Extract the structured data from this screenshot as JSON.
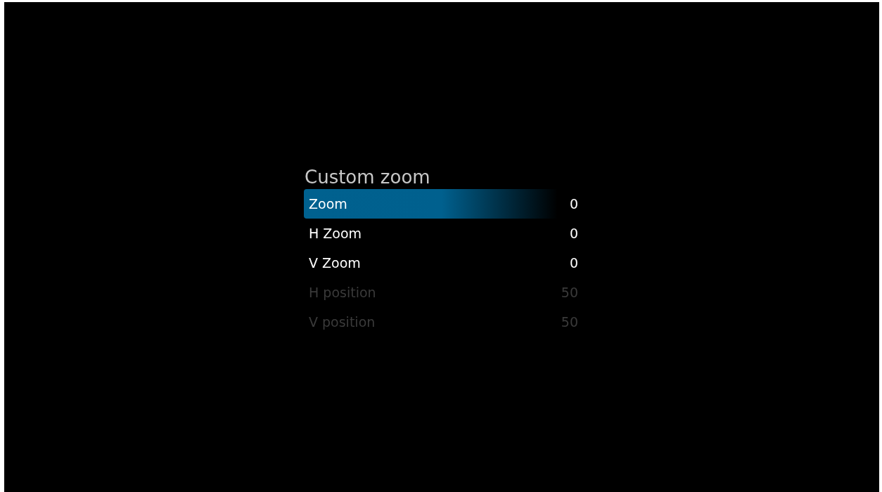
{
  "title": "Custom zoom",
  "items": [
    {
      "label": "Zoom",
      "value": "0",
      "selected": true,
      "disabled": false
    },
    {
      "label": "H Zoom",
      "value": "0",
      "selected": false,
      "disabled": false
    },
    {
      "label": "V Zoom",
      "value": "0",
      "selected": false,
      "disabled": false
    },
    {
      "label": "H position",
      "value": "50",
      "selected": false,
      "disabled": true
    },
    {
      "label": "V position",
      "value": "50",
      "selected": false,
      "disabled": true
    }
  ]
}
